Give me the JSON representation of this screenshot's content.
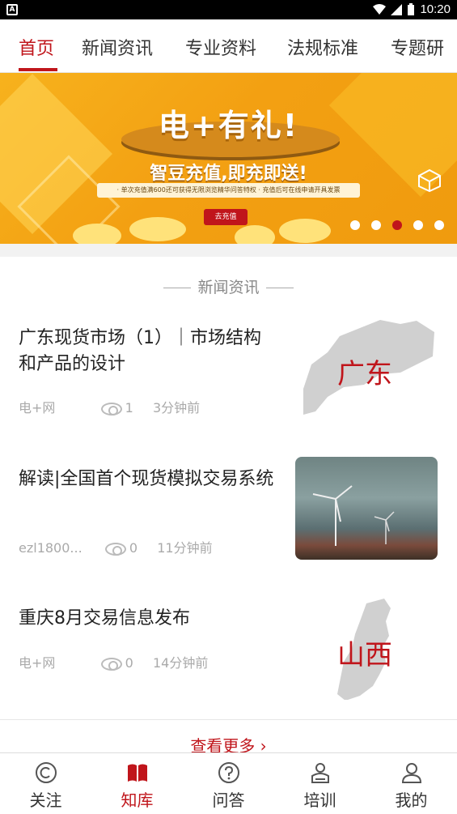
{
  "status_bar": {
    "time": "10:20",
    "left_badge": "A"
  },
  "tabs": [
    "首页",
    "新闻资讯",
    "专业资料",
    "法规标准",
    "专题研"
  ],
  "banner": {
    "title": "电+有礼!",
    "subtitle": "智豆充值,即充即送!",
    "notes": "· 单次充值满600还可获得无限浏览精华问答特权    · 充值后可在线申请开具发票",
    "button": "去充值"
  },
  "section_title": "新闻资讯",
  "news": [
    {
      "title": "广东现货市场（1）｜市场结构和产品的设计",
      "source": "电+网",
      "views": "1",
      "time": "3分钟前",
      "thumb_label": "广东"
    },
    {
      "title": "解读|全国首个现货模拟交易系统",
      "source": "ezl1800...",
      "views": "0",
      "time": "11分钟前",
      "thumb_label": ""
    },
    {
      "title": "重庆8月交易信息发布",
      "source": "电+网",
      "views": "0",
      "time": "14分钟前",
      "thumb_label": "山西"
    }
  ],
  "more_label": "查看更多 ›",
  "bottom_nav": [
    {
      "label": "关注",
      "icon": "copyright-circle-icon"
    },
    {
      "label": "知库",
      "icon": "book-icon"
    },
    {
      "label": "问答",
      "icon": "question-circle-icon"
    },
    {
      "label": "培训",
      "icon": "person-laptop-icon"
    },
    {
      "label": "我的",
      "icon": "user-icon"
    }
  ],
  "colors": {
    "accent": "#c0151b",
    "banner": "#f3a012"
  }
}
